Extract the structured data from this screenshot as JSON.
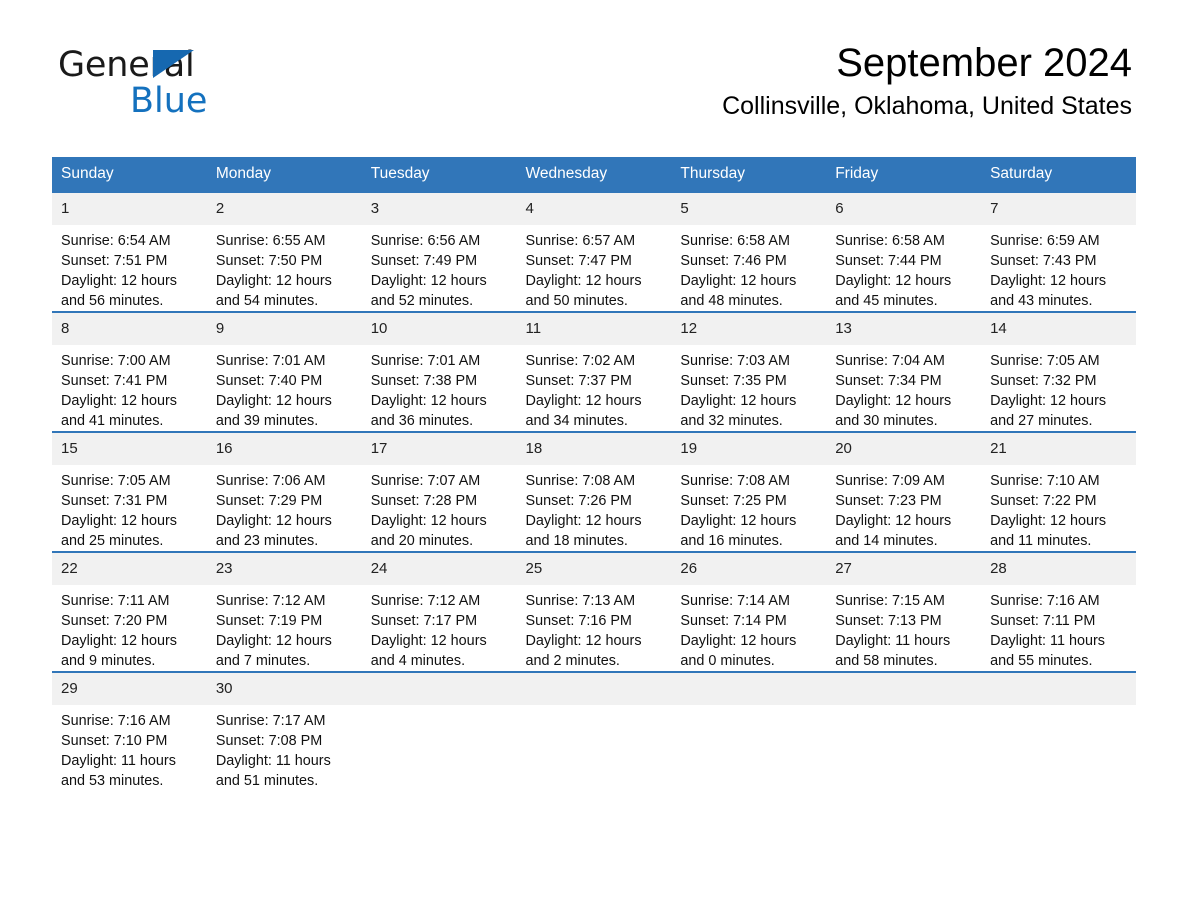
{
  "brand": {
    "name_part1": "General",
    "name_part2": "Blue",
    "accent_color": "#1471be"
  },
  "header": {
    "month_title": "September 2024",
    "location": "Collinsville, Oklahoma, United States"
  },
  "theme": {
    "header_blue": "#3176b9",
    "day_band_gray": "#f1f1f1"
  },
  "calendar": {
    "weekday_headers": [
      "Sunday",
      "Monday",
      "Tuesday",
      "Wednesday",
      "Thursday",
      "Friday",
      "Saturday"
    ],
    "weeks": [
      [
        {
          "day": "1",
          "sunrise": "Sunrise: 6:54 AM",
          "sunset": "Sunset: 7:51 PM",
          "daylight": "Daylight: 12 hours and 56 minutes."
        },
        {
          "day": "2",
          "sunrise": "Sunrise: 6:55 AM",
          "sunset": "Sunset: 7:50 PM",
          "daylight": "Daylight: 12 hours and 54 minutes."
        },
        {
          "day": "3",
          "sunrise": "Sunrise: 6:56 AM",
          "sunset": "Sunset: 7:49 PM",
          "daylight": "Daylight: 12 hours and 52 minutes."
        },
        {
          "day": "4",
          "sunrise": "Sunrise: 6:57 AM",
          "sunset": "Sunset: 7:47 PM",
          "daylight": "Daylight: 12 hours and 50 minutes."
        },
        {
          "day": "5",
          "sunrise": "Sunrise: 6:58 AM",
          "sunset": "Sunset: 7:46 PM",
          "daylight": "Daylight: 12 hours and 48 minutes."
        },
        {
          "day": "6",
          "sunrise": "Sunrise: 6:58 AM",
          "sunset": "Sunset: 7:44 PM",
          "daylight": "Daylight: 12 hours and 45 minutes."
        },
        {
          "day": "7",
          "sunrise": "Sunrise: 6:59 AM",
          "sunset": "Sunset: 7:43 PM",
          "daylight": "Daylight: 12 hours and 43 minutes."
        }
      ],
      [
        {
          "day": "8",
          "sunrise": "Sunrise: 7:00 AM",
          "sunset": "Sunset: 7:41 PM",
          "daylight": "Daylight: 12 hours and 41 minutes."
        },
        {
          "day": "9",
          "sunrise": "Sunrise: 7:01 AM",
          "sunset": "Sunset: 7:40 PM",
          "daylight": "Daylight: 12 hours and 39 minutes."
        },
        {
          "day": "10",
          "sunrise": "Sunrise: 7:01 AM",
          "sunset": "Sunset: 7:38 PM",
          "daylight": "Daylight: 12 hours and 36 minutes."
        },
        {
          "day": "11",
          "sunrise": "Sunrise: 7:02 AM",
          "sunset": "Sunset: 7:37 PM",
          "daylight": "Daylight: 12 hours and 34 minutes."
        },
        {
          "day": "12",
          "sunrise": "Sunrise: 7:03 AM",
          "sunset": "Sunset: 7:35 PM",
          "daylight": "Daylight: 12 hours and 32 minutes."
        },
        {
          "day": "13",
          "sunrise": "Sunrise: 7:04 AM",
          "sunset": "Sunset: 7:34 PM",
          "daylight": "Daylight: 12 hours and 30 minutes."
        },
        {
          "day": "14",
          "sunrise": "Sunrise: 7:05 AM",
          "sunset": "Sunset: 7:32 PM",
          "daylight": "Daylight: 12 hours and 27 minutes."
        }
      ],
      [
        {
          "day": "15",
          "sunrise": "Sunrise: 7:05 AM",
          "sunset": "Sunset: 7:31 PM",
          "daylight": "Daylight: 12 hours and 25 minutes."
        },
        {
          "day": "16",
          "sunrise": "Sunrise: 7:06 AM",
          "sunset": "Sunset: 7:29 PM",
          "daylight": "Daylight: 12 hours and 23 minutes."
        },
        {
          "day": "17",
          "sunrise": "Sunrise: 7:07 AM",
          "sunset": "Sunset: 7:28 PM",
          "daylight": "Daylight: 12 hours and 20 minutes."
        },
        {
          "day": "18",
          "sunrise": "Sunrise: 7:08 AM",
          "sunset": "Sunset: 7:26 PM",
          "daylight": "Daylight: 12 hours and 18 minutes."
        },
        {
          "day": "19",
          "sunrise": "Sunrise: 7:08 AM",
          "sunset": "Sunset: 7:25 PM",
          "daylight": "Daylight: 12 hours and 16 minutes."
        },
        {
          "day": "20",
          "sunrise": "Sunrise: 7:09 AM",
          "sunset": "Sunset: 7:23 PM",
          "daylight": "Daylight: 12 hours and 14 minutes."
        },
        {
          "day": "21",
          "sunrise": "Sunrise: 7:10 AM",
          "sunset": "Sunset: 7:22 PM",
          "daylight": "Daylight: 12 hours and 11 minutes."
        }
      ],
      [
        {
          "day": "22",
          "sunrise": "Sunrise: 7:11 AM",
          "sunset": "Sunset: 7:20 PM",
          "daylight": "Daylight: 12 hours and 9 minutes."
        },
        {
          "day": "23",
          "sunrise": "Sunrise: 7:12 AM",
          "sunset": "Sunset: 7:19 PM",
          "daylight": "Daylight: 12 hours and 7 minutes."
        },
        {
          "day": "24",
          "sunrise": "Sunrise: 7:12 AM",
          "sunset": "Sunset: 7:17 PM",
          "daylight": "Daylight: 12 hours and 4 minutes."
        },
        {
          "day": "25",
          "sunrise": "Sunrise: 7:13 AM",
          "sunset": "Sunset: 7:16 PM",
          "daylight": "Daylight: 12 hours and 2 minutes."
        },
        {
          "day": "26",
          "sunrise": "Sunrise: 7:14 AM",
          "sunset": "Sunset: 7:14 PM",
          "daylight": "Daylight: 12 hours and 0 minutes."
        },
        {
          "day": "27",
          "sunrise": "Sunrise: 7:15 AM",
          "sunset": "Sunset: 7:13 PM",
          "daylight": "Daylight: 11 hours and 58 minutes."
        },
        {
          "day": "28",
          "sunrise": "Sunrise: 7:16 AM",
          "sunset": "Sunset: 7:11 PM",
          "daylight": "Daylight: 11 hours and 55 minutes."
        }
      ],
      [
        {
          "day": "29",
          "sunrise": "Sunrise: 7:16 AM",
          "sunset": "Sunset: 7:10 PM",
          "daylight": "Daylight: 11 hours and 53 minutes."
        },
        {
          "day": "30",
          "sunrise": "Sunrise: 7:17 AM",
          "sunset": "Sunset: 7:08 PM",
          "daylight": "Daylight: 11 hours and 51 minutes."
        },
        {
          "day": "",
          "sunrise": "",
          "sunset": "",
          "daylight": ""
        },
        {
          "day": "",
          "sunrise": "",
          "sunset": "",
          "daylight": ""
        },
        {
          "day": "",
          "sunrise": "",
          "sunset": "",
          "daylight": ""
        },
        {
          "day": "",
          "sunrise": "",
          "sunset": "",
          "daylight": ""
        },
        {
          "day": "",
          "sunrise": "",
          "sunset": "",
          "daylight": ""
        }
      ]
    ]
  }
}
